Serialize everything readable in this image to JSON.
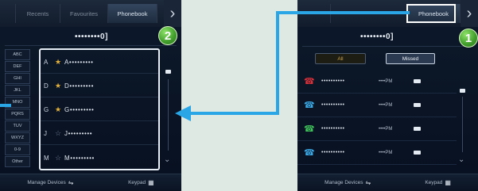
{
  "left_screen": {
    "tabs": [
      "Recents",
      "Favourites",
      "Phonebook"
    ],
    "active_tab": "Phonebook",
    "number": "••••••••0]",
    "alphabet": [
      "ABC",
      "DEF",
      "GHI",
      "JKL",
      "MNO",
      "PQRS",
      "TUV",
      "WXYZ",
      "0-9",
      "Other"
    ],
    "contacts": [
      {
        "initial": "A",
        "favourite": true,
        "name": "A•••••••••"
      },
      {
        "initial": "D",
        "favourite": true,
        "name": "D•••••••••"
      },
      {
        "initial": "G",
        "favourite": true,
        "name": "G•••••••••"
      },
      {
        "initial": "J",
        "favourite": false,
        "name": "J•••••••••"
      },
      {
        "initial": "M",
        "favourite": false,
        "name": "M•••••••••"
      }
    ],
    "bottom": {
      "manage": "Manage Devices",
      "keypad": "Keypad"
    }
  },
  "right_screen": {
    "active_tab": "Phonebook",
    "number": "••••••••0]",
    "filters": {
      "all": "All",
      "missed": "Missed"
    },
    "calls": [
      {
        "icon": "missed-call",
        "number": "••••••••••",
        "time": "••••PM"
      },
      {
        "icon": "outgoing-call",
        "number": "••••••••••",
        "time": "••••PM"
      },
      {
        "icon": "incoming-call",
        "number": "••••••••••",
        "time": "••••PM"
      },
      {
        "icon": "outgoing-call",
        "number": "••••••••••",
        "time": "••••PM"
      }
    ],
    "bottom": {
      "manage": "Manage Devices",
      "keypad": "Keypad"
    }
  },
  "markers": {
    "step1": "1",
    "step2": "2"
  },
  "colors": {
    "connector": "#2aa6e6",
    "marker": "#4caf2f",
    "star": "#e3b23c",
    "missed": "#d8313a",
    "incoming": "#3fc25a",
    "outgoing": "#3aa9e6"
  }
}
